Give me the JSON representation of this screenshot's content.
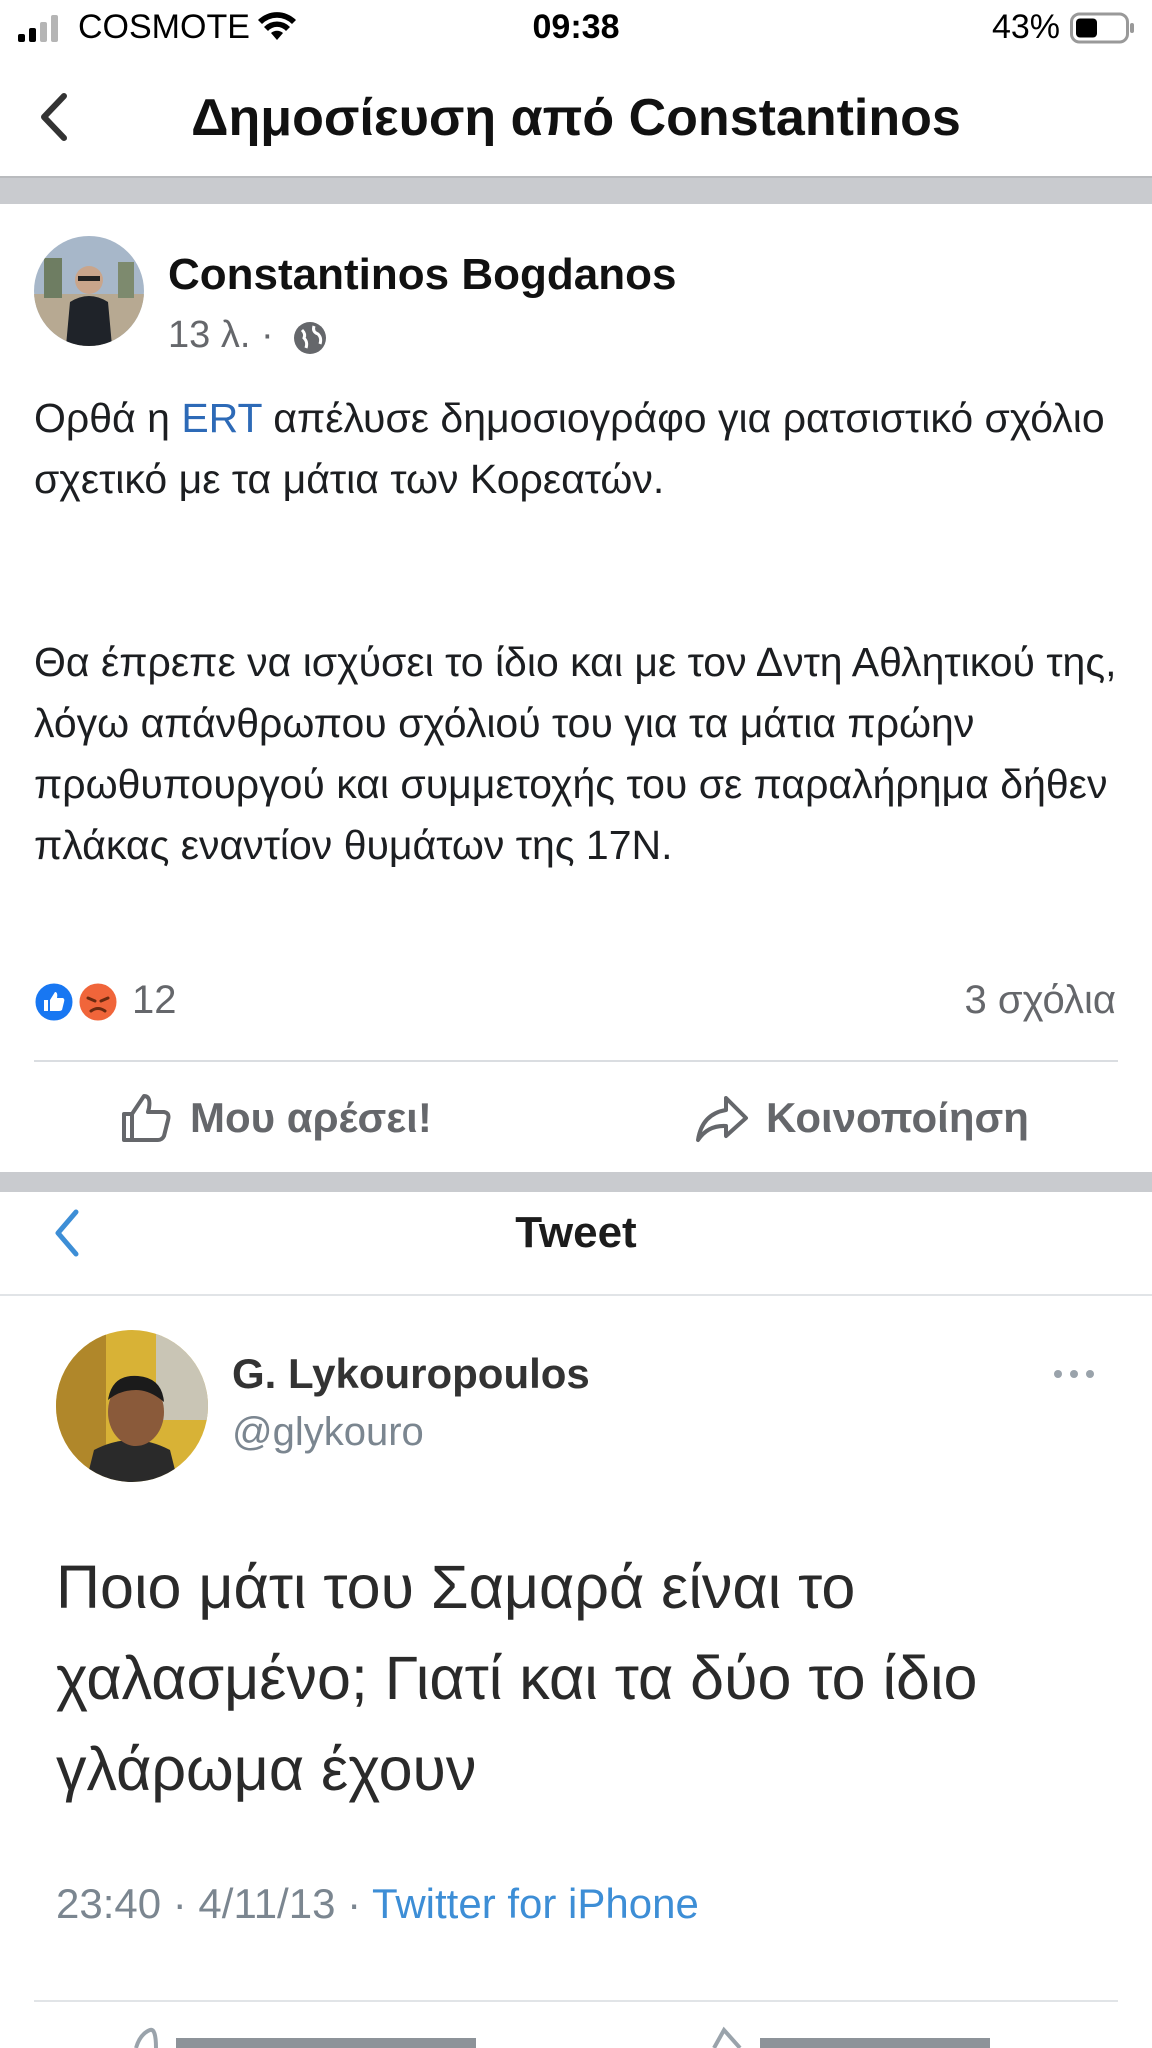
{
  "status_bar": {
    "carrier": "COSMOTE",
    "time": "09:38",
    "battery": "43%"
  },
  "facebook_post": {
    "header_title": "Δημοσίευση από Constantinos",
    "author": "Constantinos Bogdanos",
    "time_ago": "13 λ. ·",
    "text_para1_before": "Ορθά η ",
    "text_para1_link": "ERT",
    "text_para1_after": " απέλυσε δημοσιογράφο για ρατσιστικό σχόλιο σχετικό με τα μάτια των Κορεατών.",
    "text_para2": "Θα έπρεπε να ισχύσει το ίδιο και με τον Δντη Αθλητικού της, λόγω απάνθρωπου σχόλιού του για τα μάτια πρώην πρωθυπουργού και συμμετοχής του σε παραλήρημα δήθεν πλάκας εναντίον θυμάτων της 17Ν.",
    "reaction_count": "12",
    "comment_count": "3 σχόλια",
    "like_label": "Μου αρέσει!",
    "share_label": "Κοινοποίηση"
  },
  "tweet": {
    "header_title": "Tweet",
    "name": "G. Lykouropoulos",
    "handle": "@glykouro",
    "text": "Ποιο μάτι του Σαμαρά είναι το χαλασμένο; Γιατί και τα δύο το ίδιο γλάρωμα έχουν",
    "time_date": "23:40 · 4/11/13 · ",
    "source": "Twitter for iPhone"
  },
  "colors": {
    "link": "#2d6ab7",
    "twitter_blue": "#3d8ed6",
    "muted": "#65676b",
    "divider": "#c9cbcf"
  },
  "icons": [
    "signal-icon",
    "wifi-icon",
    "battery-icon",
    "back-chevron-icon",
    "globe-icon",
    "like-emoji-icon",
    "angry-emoji-icon",
    "thumbs-up-icon",
    "share-arrow-icon",
    "more-dots-icon"
  ]
}
